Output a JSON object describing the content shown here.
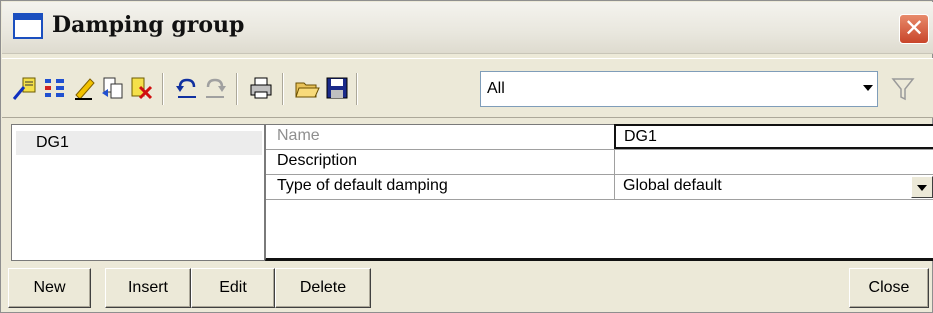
{
  "window": {
    "title": "Damping group",
    "close_glyph": "✕"
  },
  "toolbar": {
    "icons": [
      "new-record-icon",
      "align-icon",
      "edit-pencil-icon",
      "copy-icon",
      "delete-icon",
      "undo-icon",
      "redo-icon",
      "print-icon",
      "open-folder-icon",
      "save-icon",
      "filter-icon"
    ],
    "filter_value": "All"
  },
  "list": {
    "items": [
      {
        "label": "DG1"
      }
    ]
  },
  "properties": {
    "rows": [
      {
        "name": "Name",
        "value": "DG1"
      },
      {
        "name": "Description",
        "value": ""
      },
      {
        "name": "Type of default damping",
        "value": "Global default"
      }
    ]
  },
  "buttons": {
    "new": "New",
    "insert": "Insert",
    "edit": "Edit",
    "delete": "Delete",
    "close": "Close"
  }
}
